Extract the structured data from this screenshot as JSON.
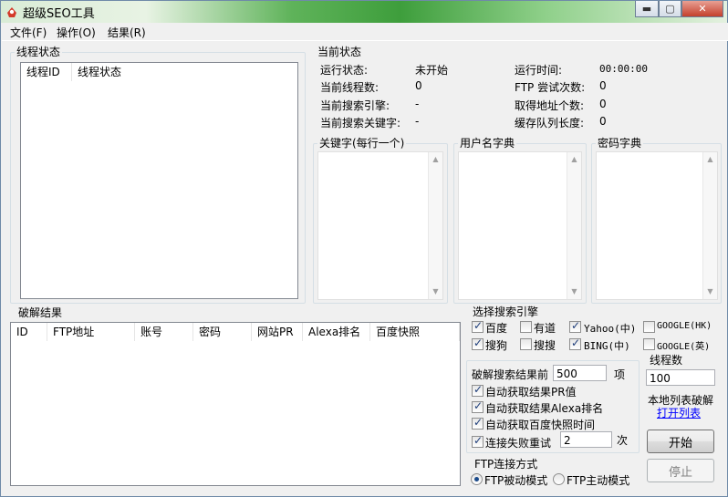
{
  "window": {
    "title": "超级SEO工具",
    "buttons": {
      "minimize": "▬",
      "maximize": "▢",
      "close": "✕"
    }
  },
  "menu": [
    {
      "label": "文件(F)"
    },
    {
      "label": "操作(O)"
    },
    {
      "label": "结果(R)"
    }
  ],
  "thread_status": {
    "group_label": "线程状态",
    "columns": [
      "线程ID",
      "线程状态"
    ]
  },
  "current_status": {
    "group_label": "当前状态",
    "run_status_label": "运行状态:",
    "run_status_value": "未开始",
    "run_time_label": "运行时间:",
    "run_time_value": "00:00:00",
    "thread_count_label": "当前线程数:",
    "thread_count_value": "0",
    "ftp_attempts_label": "FTP 尝试次数:",
    "ftp_attempts_value": "0",
    "engine_label": "当前搜索引擎:",
    "engine_value": "-",
    "addr_count_label": "取得地址个数:",
    "addr_count_value": "0",
    "keyword_label": "当前搜索关键字:",
    "keyword_value": "-",
    "queue_label": "缓存队列长度:",
    "queue_value": "0"
  },
  "keywords": {
    "group_label": "关键字(每行一个)"
  },
  "usernames": {
    "group_label": "用户名字典"
  },
  "passwords": {
    "group_label": "密码字典"
  },
  "results": {
    "group_label": "破解结果",
    "columns": [
      "ID",
      "FTP地址",
      "账号",
      "密码",
      "网站PR",
      "Alexa排名",
      "百度快照"
    ]
  },
  "engines": {
    "group_label": "选择搜索引擎",
    "items": [
      {
        "label": "百度",
        "checked": true
      },
      {
        "label": "有道",
        "checked": false
      },
      {
        "label": "Yahoo(中)",
        "checked": true
      },
      {
        "label": "GOOGLE(HK)",
        "checked": false
      },
      {
        "label": "搜狗",
        "checked": true
      },
      {
        "label": "搜搜",
        "checked": false
      },
      {
        "label": "BING(中)",
        "checked": true
      },
      {
        "label": "GOOGLE(英)",
        "checked": false
      }
    ]
  },
  "options": {
    "crack_prefix_label": "破解搜索结果前",
    "crack_count": "500",
    "crack_suffix_label": "项",
    "auto_pr": {
      "label": "自动获取结果PR值",
      "checked": true
    },
    "auto_alexa": {
      "label": "自动获取结果Alexa排名",
      "checked": true
    },
    "auto_baidu": {
      "label": "自动获取百度快照时间",
      "checked": true
    },
    "retry": {
      "label": "连接失败重试",
      "checked": true,
      "value": "2",
      "suffix": "次"
    }
  },
  "ftp_mode": {
    "group_label": "FTP连接方式",
    "passive_label": "FTP被动模式",
    "passive_checked": true,
    "active_label": "FTP主动模式",
    "active_checked": false
  },
  "threads": {
    "group_label": "线程数",
    "value": "100"
  },
  "local_list": {
    "label": "本地列表破解",
    "link": "打开列表"
  },
  "actions": {
    "start": "开始",
    "stop": "停止"
  }
}
